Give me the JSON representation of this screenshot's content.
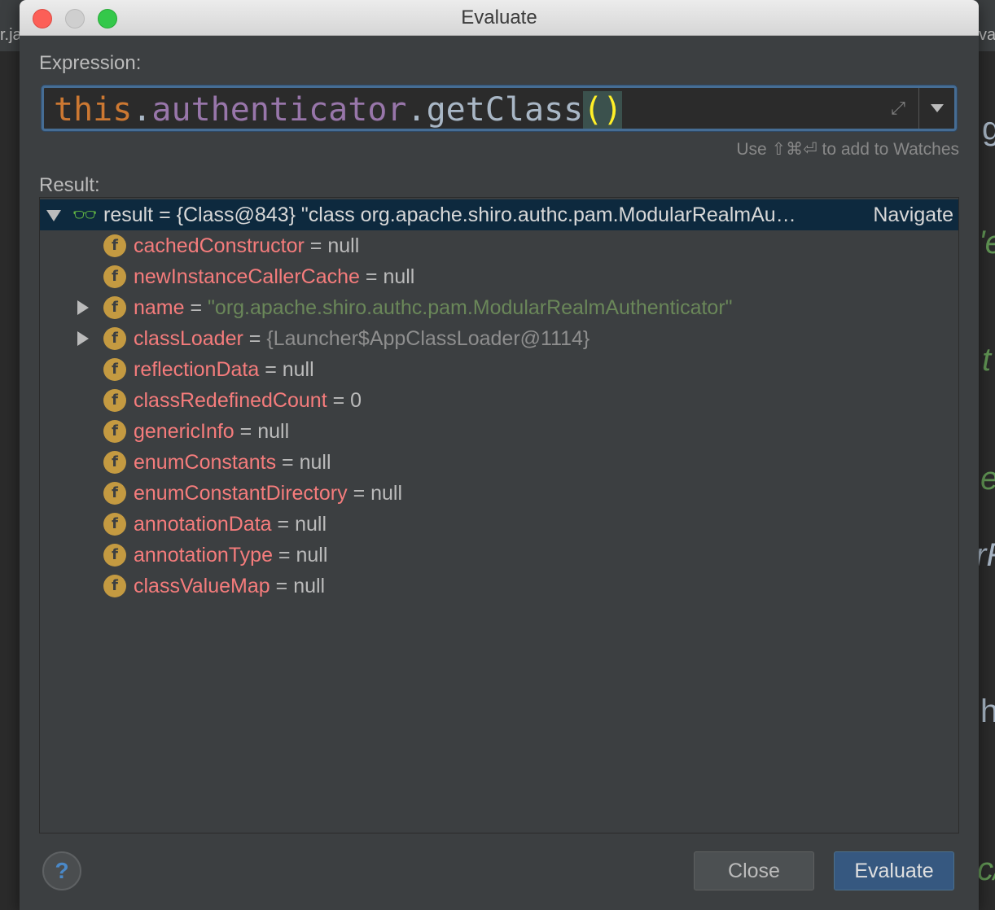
{
  "background": {
    "tab_left": "r.ja",
    "tab_right": "va",
    "code_fragments": [
      "g",
      "'e",
      "t",
      "e",
      "rR",
      "h",
      "c/"
    ]
  },
  "dialog": {
    "title": "Evaluate",
    "expression_label": "Expression:",
    "expression": {
      "keyword": "this",
      "dot1": ".",
      "field": "authenticator",
      "dot2": ".",
      "method": "getClass",
      "parens": "()"
    },
    "expand_icon": "expand-icon",
    "hint": "Use ⇧⌘⏎ to add to Watches",
    "result_label": "Result:",
    "result": {
      "root": {
        "name": "result",
        "eq": " = ",
        "value": "{Class@843} \"class org.apache.shiro.authc.pam.ModularRealmAu…",
        "navigate": "Navigate",
        "icon": "watch-glasses-icon"
      },
      "fields": [
        {
          "name": "cachedConstructor",
          "eq": " = ",
          "value": "null",
          "kind": "val",
          "expandable": false
        },
        {
          "name": "newInstanceCallerCache",
          "eq": " = ",
          "value": "null",
          "kind": "val",
          "expandable": false
        },
        {
          "name": "name",
          "eq": " = ",
          "value": "\"org.apache.shiro.authc.pam.ModularRealmAuthenticator\"",
          "kind": "str",
          "expandable": true
        },
        {
          "name": "classLoader",
          "eq": " = ",
          "value": "{Launcher$AppClassLoader@1114}",
          "kind": "obj",
          "expandable": true
        },
        {
          "name": "reflectionData",
          "eq": " = ",
          "value": "null",
          "kind": "val",
          "expandable": false
        },
        {
          "name": "classRedefinedCount",
          "eq": " = ",
          "value": "0",
          "kind": "val",
          "expandable": false
        },
        {
          "name": "genericInfo",
          "eq": " = ",
          "value": "null",
          "kind": "val",
          "expandable": false
        },
        {
          "name": "enumConstants",
          "eq": " = ",
          "value": "null",
          "kind": "val",
          "expandable": false
        },
        {
          "name": "enumConstantDirectory",
          "eq": " = ",
          "value": "null",
          "kind": "val",
          "expandable": false
        },
        {
          "name": "annotationData",
          "eq": " = ",
          "value": "null",
          "kind": "val",
          "expandable": false
        },
        {
          "name": "annotationType",
          "eq": " = ",
          "value": "null",
          "kind": "val",
          "expandable": false
        },
        {
          "name": "classValueMap",
          "eq": " = ",
          "value": "null",
          "kind": "val",
          "expandable": false
        }
      ],
      "field_icon_letter": "f"
    },
    "help_label": "?",
    "close_label": "Close",
    "evaluate_label": "Evaluate"
  },
  "colors": {
    "field_name": "#f57c7c",
    "string_value": "#6a8759",
    "selection": "#0d293e",
    "primary_button": "#365880",
    "field_icon": "#c49a41"
  }
}
